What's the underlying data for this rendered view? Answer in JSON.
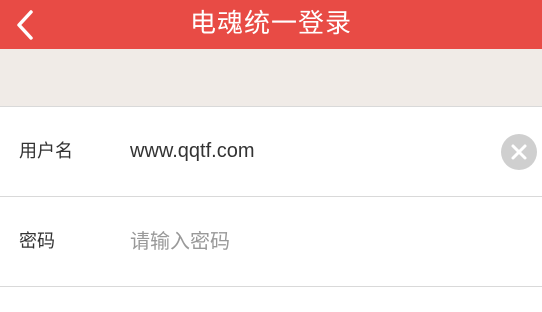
{
  "header": {
    "title": "电魂统一登录",
    "back_icon": "chevron-left-icon",
    "background_color": "#E84B45"
  },
  "form": {
    "username": {
      "label": "用户名",
      "value": "www.qqtf.com",
      "clear_icon": "close-icon"
    },
    "password": {
      "label": "密码",
      "placeholder": "请输入密码"
    }
  }
}
